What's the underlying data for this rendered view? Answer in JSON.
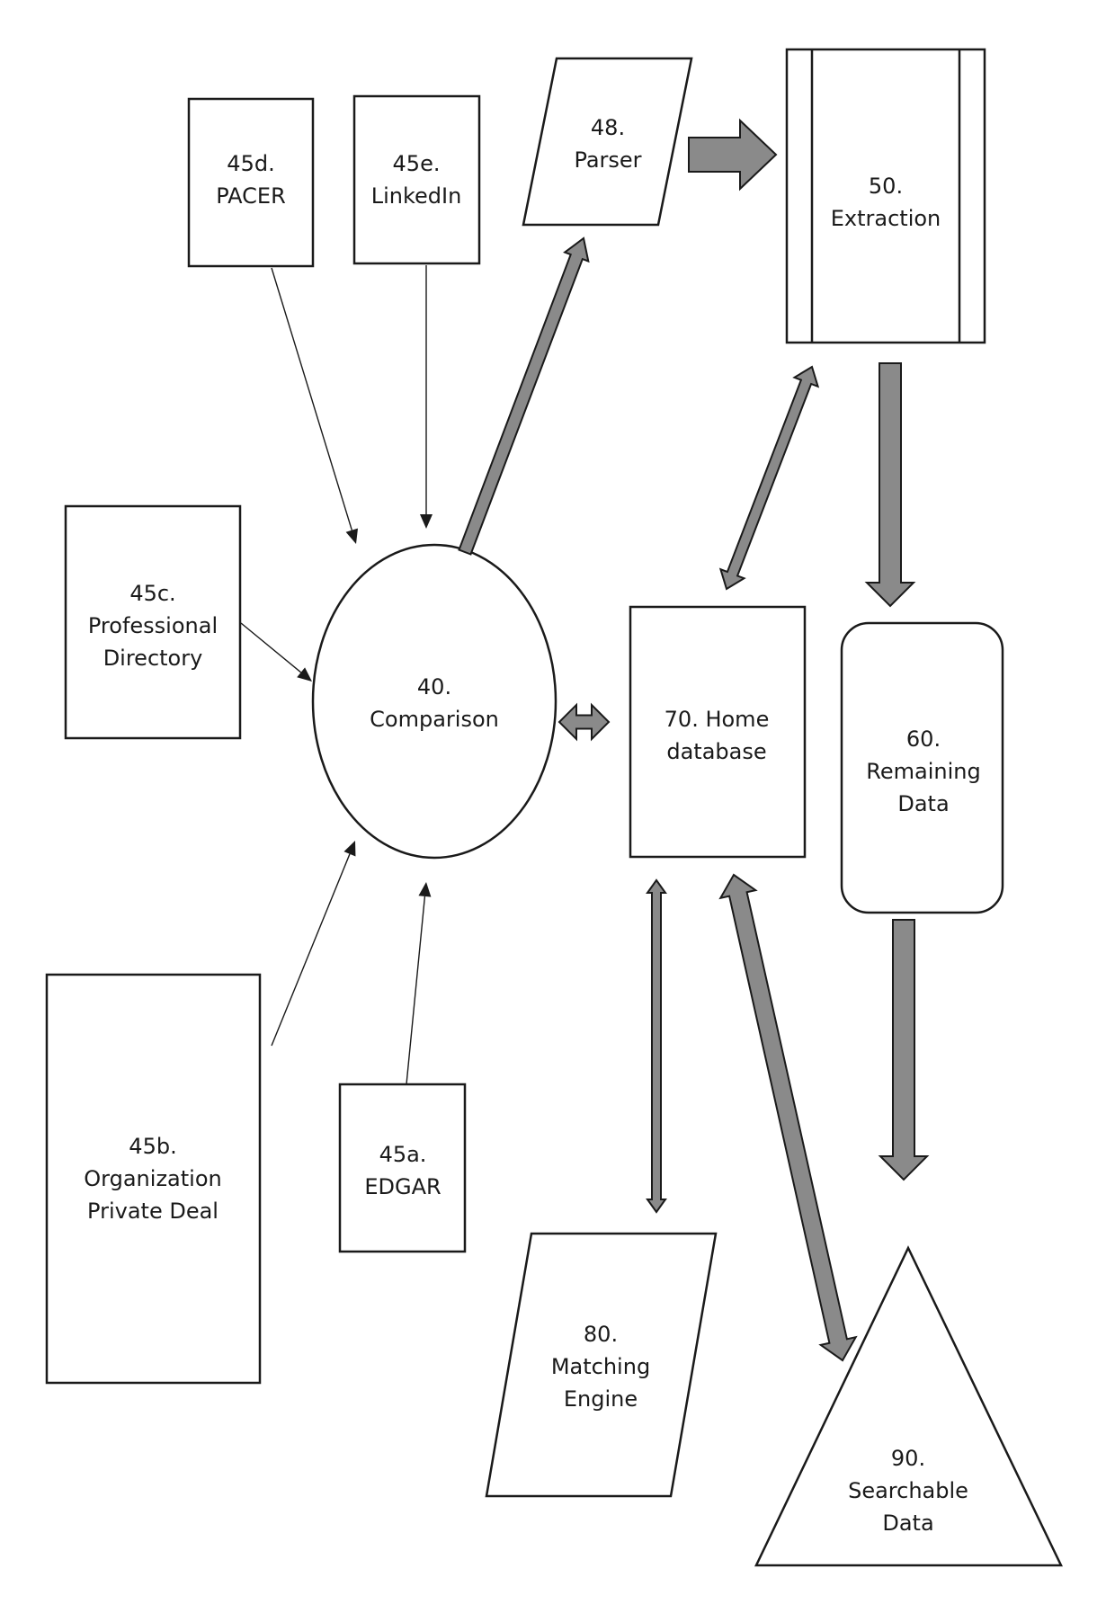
{
  "diagram": {
    "nodes": {
      "pacer": {
        "id": "45d.",
        "name": "PACER"
      },
      "linkedin": {
        "id": "45e.",
        "name": "LinkedIn"
      },
      "parser": {
        "id": "48.",
        "name": "Parser"
      },
      "extraction": {
        "id": "50.",
        "name": "Extraction"
      },
      "professional_directory": {
        "id": "45c.",
        "name1": "Professional",
        "name2": "Directory"
      },
      "comparison": {
        "id": "40.",
        "name": "Comparison"
      },
      "home_database": {
        "line1": "70. Home",
        "line2": "database"
      },
      "remaining_data": {
        "id": "60.",
        "name1": "Remaining",
        "name2": "Data"
      },
      "organization_private_deal": {
        "id": "45b.",
        "name1": "Organization",
        "name2": "Private Deal"
      },
      "edgar": {
        "id": "45a.",
        "name": "EDGAR"
      },
      "matching_engine": {
        "id": "80.",
        "name1": "Matching",
        "name2": "Engine"
      },
      "searchable_data": {
        "id": "90.",
        "name1": "Searchable",
        "name2": "Data"
      }
    },
    "edges": [
      {
        "from": "45d. PACER",
        "to": "40. Comparison",
        "style": "thin",
        "direction": "forward"
      },
      {
        "from": "45e. LinkedIn",
        "to": "40. Comparison",
        "style": "thin",
        "direction": "forward"
      },
      {
        "from": "45c. Professional Directory",
        "to": "40. Comparison",
        "style": "thin",
        "direction": "forward"
      },
      {
        "from": "45b. Organization Private Deal",
        "to": "40. Comparison",
        "style": "thin",
        "direction": "forward"
      },
      {
        "from": "45a. EDGAR",
        "to": "40. Comparison",
        "style": "thin",
        "direction": "forward"
      },
      {
        "from": "40. Comparison",
        "to": "48. Parser",
        "style": "block",
        "direction": "forward"
      },
      {
        "from": "48. Parser",
        "to": "50. Extraction",
        "style": "block",
        "direction": "forward"
      },
      {
        "from": "50. Extraction",
        "to": "60. Remaining Data",
        "style": "block",
        "direction": "forward"
      },
      {
        "from": "60. Remaining Data",
        "to": "90. Searchable Data",
        "style": "block",
        "direction": "forward"
      },
      {
        "from": "40. Comparison",
        "to": "70. Home database",
        "style": "block",
        "direction": "both"
      },
      {
        "from": "70. Home database",
        "to": "50. Extraction",
        "style": "block",
        "direction": "both"
      },
      {
        "from": "70. Home database",
        "to": "80. Matching Engine",
        "style": "block",
        "direction": "both"
      },
      {
        "from": "70. Home database",
        "to": "90. Searchable Data",
        "style": "block",
        "direction": "both"
      }
    ],
    "colors": {
      "stroke": "#1a1a1a",
      "arrow_fill": "#8a8a8a",
      "background": "#ffffff"
    }
  }
}
